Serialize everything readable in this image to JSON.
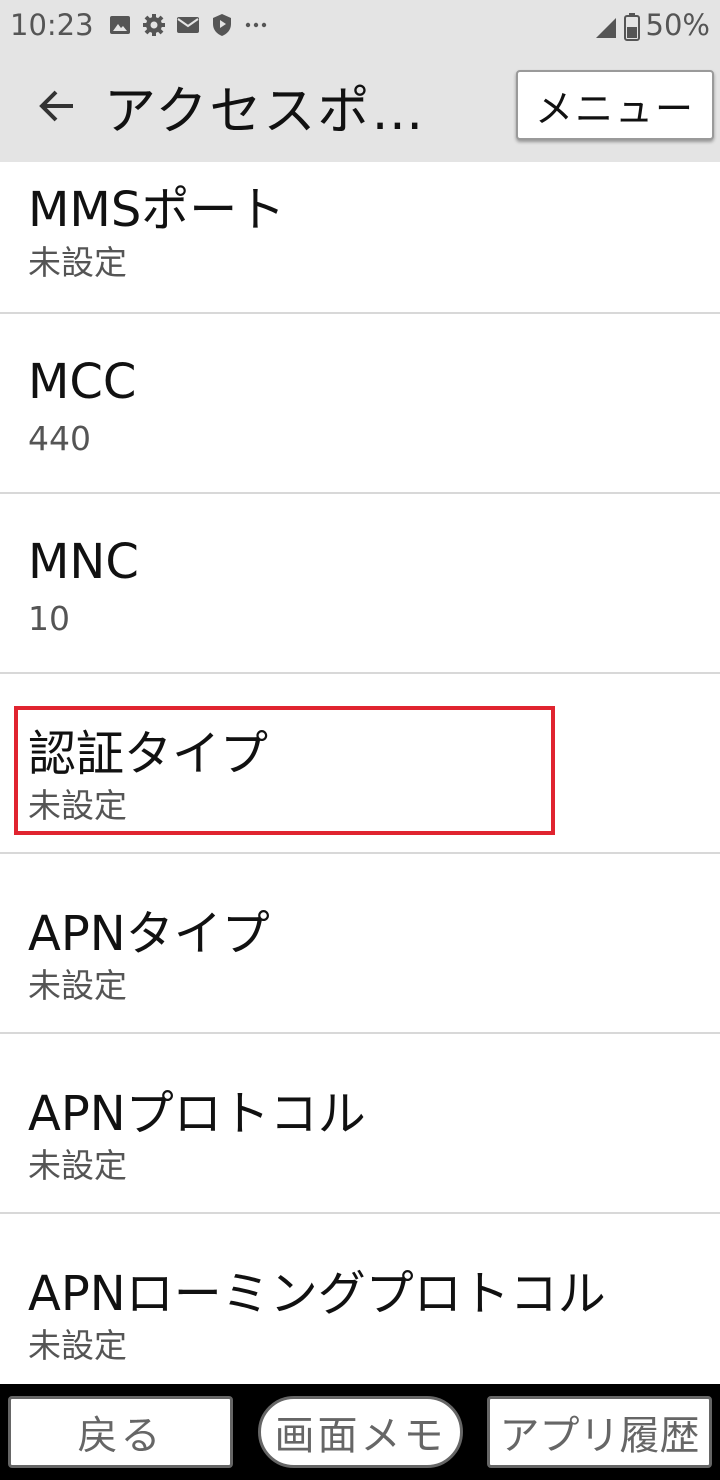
{
  "status_bar": {
    "time": "10:23",
    "battery": "50%",
    "left_icons": [
      "image-icon",
      "gear-icon",
      "mail-icon",
      "shield-icon",
      "more-icon"
    ],
    "right_icons": [
      "signal-icon",
      "battery-icon"
    ]
  },
  "toolbar": {
    "title": "アクセスポイ…",
    "menu_label": "メニュー"
  },
  "list": {
    "items": [
      {
        "title": "MMSポート",
        "value": "未設定"
      },
      {
        "title": "MCC",
        "value": "440"
      },
      {
        "title": "MNC",
        "value": "10"
      },
      {
        "title": "認証タイプ",
        "value": "未設定"
      },
      {
        "title": "APNタイプ",
        "value": "未設定"
      },
      {
        "title": "APNプロトコル",
        "value": "未設定"
      },
      {
        "title": "APNローミングプロトコル",
        "value": "未設定"
      }
    ]
  },
  "highlight_color": "#e0242f",
  "nav_bar": {
    "back_label": "戻る",
    "memo_label": "画面メモ",
    "history_label": "アプリ履歴"
  }
}
